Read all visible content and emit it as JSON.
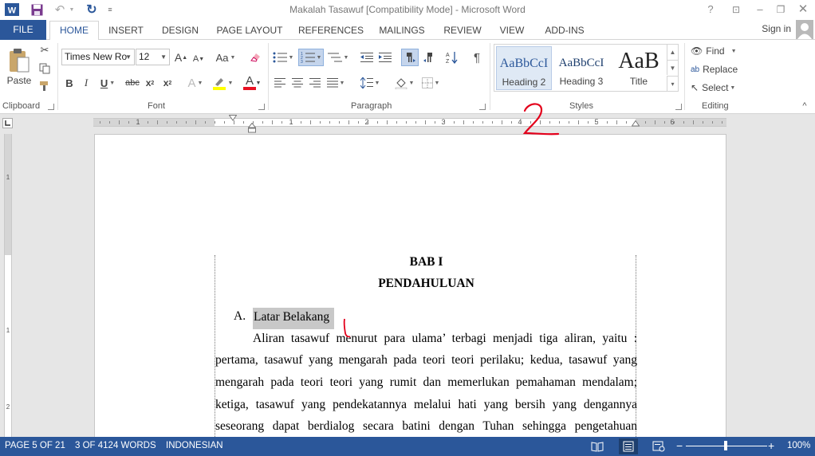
{
  "window": {
    "title": "Makalah Tasawuf [Compatibility Mode] - Microsoft Word",
    "help_label": "?"
  },
  "tabs": {
    "file": "FILE",
    "items": [
      "HOME",
      "INSERT",
      "DESIGN",
      "PAGE LAYOUT",
      "REFERENCES",
      "MAILINGS",
      "REVIEW",
      "VIEW",
      "ADD-INS"
    ],
    "active": "HOME",
    "sign_in": "Sign in"
  },
  "ribbon": {
    "clipboard": {
      "label": "Clipboard",
      "paste": "Paste"
    },
    "font": {
      "label": "Font",
      "font_name": "Times New Ro",
      "font_size": "12",
      "grow": "A",
      "shrink": "A",
      "change_case": "Aa",
      "bold": "B",
      "italic": "I",
      "underline": "U",
      "strikethrough": "abc",
      "subscript": "x",
      "superscript": "x",
      "sub_mark": "2",
      "sup_mark": "2",
      "text_effects": "A",
      "font_color": "A",
      "font_color_hex": "#e81123",
      "highlight_hex": "#ffff00"
    },
    "paragraph": {
      "label": "Paragraph",
      "pilcrow": "¶"
    },
    "styles": {
      "label": "Styles",
      "items": [
        {
          "sample": "AaBbCcI",
          "name": "Heading 2"
        },
        {
          "sample": "AaBbCcI",
          "name": "Heading 3"
        },
        {
          "sample": "AaB",
          "name": "Title"
        }
      ]
    },
    "editing": {
      "label": "Editing",
      "find": "Find",
      "replace": "Replace",
      "select": "Select"
    }
  },
  "ruler": {
    "numbers": [
      "1",
      "1",
      "2",
      "3",
      "4",
      "5",
      "6"
    ],
    "vertical_numbers": [
      "1",
      "1",
      "2"
    ]
  },
  "annotations": {
    "big_number": "2"
  },
  "document": {
    "chapter": "BAB I",
    "chapter_title": "PENDAHULUAN",
    "section_marker": "A.",
    "section_title": "Latar Belakang",
    "lines": [
      "Aliran tasawuf menurut para ulama’ terbagi menjadi tiga aliran, yaitu :",
      "pertama, tasawuf yang mengarah pada teori teori perilaku; kedua, tasawuf yang",
      "mengarah pada teori teori yang rumit dan memerlukan pemahaman mendalam;",
      "ketiga, tasawuf yang pendekatannya melalui hati yang bersih yang dengannya",
      "seseorang dapat berdialog secara batini dengan Tuhan sehingga pengetahuan"
    ]
  },
  "status": {
    "page": "PAGE 5 OF 21",
    "words": "3 OF 4124 WORDS",
    "language": "INDONESIAN",
    "zoom": "100%",
    "zoom_minus": "−",
    "zoom_plus": "+"
  },
  "colors": {
    "accent": "#2b579a",
    "annotation_red": "#e3001b",
    "selection": "#c8c8c8"
  }
}
